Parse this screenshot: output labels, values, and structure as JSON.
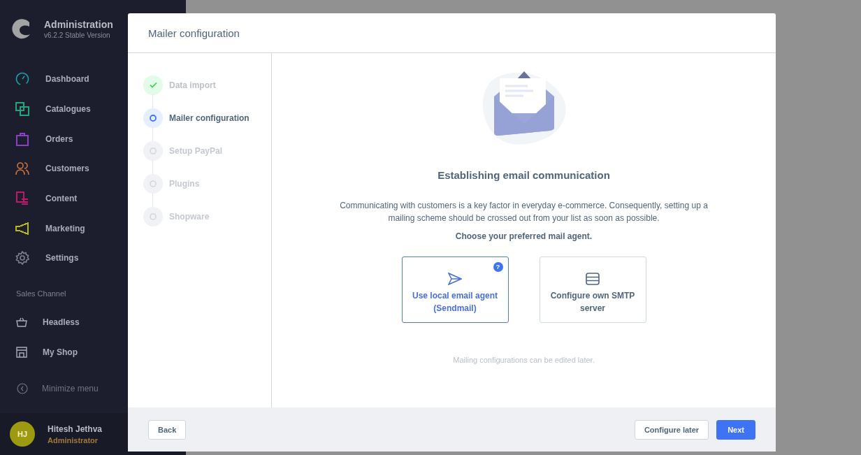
{
  "app": {
    "title": "Administration",
    "version": "v6.2.2 Stable Version"
  },
  "nav": [
    {
      "label": "Dashboard",
      "color": "#1a9fab"
    },
    {
      "label": "Catalogues",
      "color": "#23a47b"
    },
    {
      "label": "Orders",
      "color": "#8d3fc6"
    },
    {
      "label": "Customers",
      "color": "#d2733a"
    },
    {
      "label": "Content",
      "color": "#c0196b"
    },
    {
      "label": "Marketing",
      "color": "#b8b914"
    },
    {
      "label": "Settings",
      "color": "#7d8190"
    }
  ],
  "sales_channel": {
    "heading": "Sales Channel",
    "items": [
      {
        "label": "Headless"
      },
      {
        "label": "My Shop"
      }
    ]
  },
  "minimize": "Minimize menu",
  "user": {
    "initials": "HJ",
    "name": "Hitesh Jethva",
    "role": "Administrator"
  },
  "modal": {
    "title": "Mailer configuration",
    "steps": [
      {
        "label": "Data import",
        "completed": true,
        "selected": false
      },
      {
        "label": "Mailer configuration",
        "completed": false,
        "selected": true
      },
      {
        "label": "Setup PayPal",
        "completed": false,
        "selected": false
      },
      {
        "label": "Plugins",
        "completed": false,
        "selected": false
      },
      {
        "label": "Shopware",
        "completed": false,
        "selected": false
      }
    ],
    "heading": "Establishing email communication",
    "description": "Communicating with customers is a key factor in everyday e-commerce. Consequently, setting up a mailing scheme should be crossed out from your list as soon as possible.",
    "prompt": "Choose your preferred mail agent.",
    "options": [
      {
        "label": "Use local email agent (Sendmail)",
        "selected": true,
        "help": "?"
      },
      {
        "label": "Configure own SMTP server",
        "selected": false
      }
    ],
    "note": "Mailing configurations can be edited later.",
    "buttons": {
      "back": "Back",
      "later": "Configure later",
      "next": "Next"
    }
  }
}
